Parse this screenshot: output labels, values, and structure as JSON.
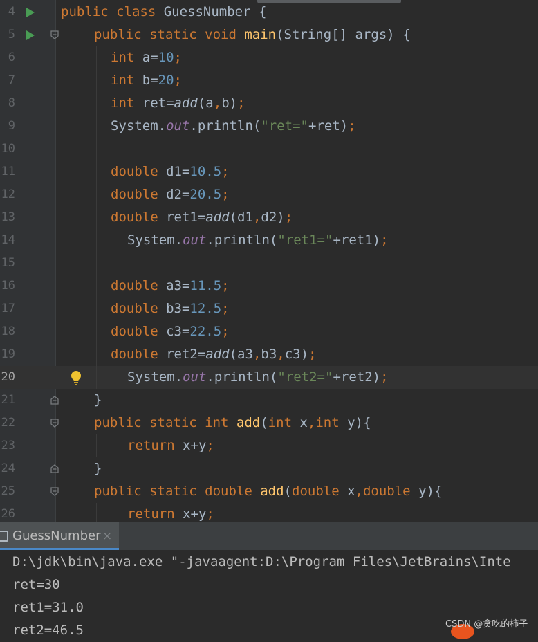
{
  "editor": {
    "lines": [
      {
        "n": "4",
        "tokens": [
          [
            "kw",
            "public class "
          ],
          [
            "p",
            "GuessNumber {"
          ]
        ]
      },
      {
        "n": "5",
        "tokens": [
          [
            "kw",
            "public static void "
          ],
          [
            "fn",
            "main"
          ],
          [
            "p",
            "(String[] args) {"
          ]
        ]
      },
      {
        "n": "6",
        "tokens": [
          [
            "kw",
            "int "
          ],
          [
            "p",
            "a="
          ],
          [
            "num",
            "10"
          ],
          [
            "kw",
            ";"
          ]
        ]
      },
      {
        "n": "7",
        "tokens": [
          [
            "kw",
            "int "
          ],
          [
            "p",
            "b="
          ],
          [
            "num",
            "20"
          ],
          [
            "kw",
            ";"
          ]
        ]
      },
      {
        "n": "8",
        "tokens": [
          [
            "kw",
            "int "
          ],
          [
            "p",
            "ret="
          ],
          [
            "it",
            "add"
          ],
          [
            "p",
            "(a"
          ],
          [
            "kw",
            ","
          ],
          [
            "p",
            "b)"
          ],
          [
            "kw",
            ";"
          ]
        ]
      },
      {
        "n": "9",
        "tokens": [
          [
            "p",
            "System."
          ],
          [
            "fld",
            "out"
          ],
          [
            "p",
            ".println("
          ],
          [
            "str",
            "\"ret=\""
          ],
          [
            "p",
            "+ret)"
          ],
          [
            "kw",
            ";"
          ]
        ]
      },
      {
        "n": "10",
        "tokens": []
      },
      {
        "n": "11",
        "tokens": [
          [
            "kw",
            "double "
          ],
          [
            "p",
            "d1="
          ],
          [
            "num",
            "10.5"
          ],
          [
            "kw",
            ";"
          ]
        ]
      },
      {
        "n": "12",
        "tokens": [
          [
            "kw",
            "double "
          ],
          [
            "p",
            "d2="
          ],
          [
            "num",
            "20.5"
          ],
          [
            "kw",
            ";"
          ]
        ]
      },
      {
        "n": "13",
        "tokens": [
          [
            "kw",
            "double "
          ],
          [
            "p",
            "ret1="
          ],
          [
            "it",
            "add"
          ],
          [
            "p",
            "(d1"
          ],
          [
            "kw",
            ","
          ],
          [
            "p",
            "d2)"
          ],
          [
            "kw",
            ";"
          ]
        ]
      },
      {
        "n": "14",
        "tokens": [
          [
            "p",
            "System."
          ],
          [
            "fld",
            "out"
          ],
          [
            "p",
            ".println("
          ],
          [
            "str",
            "\"ret1=\""
          ],
          [
            "p",
            "+ret1)"
          ],
          [
            "kw",
            ";"
          ]
        ]
      },
      {
        "n": "15",
        "tokens": []
      },
      {
        "n": "16",
        "tokens": [
          [
            "kw",
            "double "
          ],
          [
            "p",
            "a3="
          ],
          [
            "num",
            "11.5"
          ],
          [
            "kw",
            ";"
          ]
        ]
      },
      {
        "n": "17",
        "tokens": [
          [
            "kw",
            "double "
          ],
          [
            "p",
            "b3="
          ],
          [
            "num",
            "12.5"
          ],
          [
            "kw",
            ";"
          ]
        ]
      },
      {
        "n": "18",
        "tokens": [
          [
            "kw",
            "double "
          ],
          [
            "p",
            "c3="
          ],
          [
            "num",
            "22.5"
          ],
          [
            "kw",
            ";"
          ]
        ]
      },
      {
        "n": "19",
        "tokens": [
          [
            "kw",
            "double "
          ],
          [
            "p",
            "ret2="
          ],
          [
            "it",
            "add"
          ],
          [
            "p",
            "(a3"
          ],
          [
            "kw",
            ","
          ],
          [
            "p",
            "b3"
          ],
          [
            "kw",
            ","
          ],
          [
            "p",
            "c3)"
          ],
          [
            "kw",
            ";"
          ]
        ]
      },
      {
        "n": "20",
        "tokens": [
          [
            "p",
            "System."
          ],
          [
            "fld",
            "out"
          ],
          [
            "p",
            ".println("
          ],
          [
            "str",
            "\"ret2=\""
          ],
          [
            "p",
            "+ret2)"
          ],
          [
            "kw",
            ";"
          ]
        ]
      },
      {
        "n": "21",
        "tokens": [
          [
            "p",
            "}"
          ]
        ]
      },
      {
        "n": "22",
        "tokens": [
          [
            "kw",
            "public static int "
          ],
          [
            "fn",
            "add"
          ],
          [
            "p",
            "("
          ],
          [
            "kw",
            "int "
          ],
          [
            "p",
            "x"
          ],
          [
            "kw",
            ","
          ],
          [
            "kw",
            "int "
          ],
          [
            "p",
            "y){"
          ]
        ]
      },
      {
        "n": "23",
        "tokens": [
          [
            "kw",
            "return "
          ],
          [
            "p",
            "x+y"
          ],
          [
            "kw",
            ";"
          ]
        ]
      },
      {
        "n": "24",
        "tokens": [
          [
            "p",
            "}"
          ]
        ]
      },
      {
        "n": "25",
        "tokens": [
          [
            "kw",
            "public static double "
          ],
          [
            "fn",
            "add"
          ],
          [
            "p",
            "("
          ],
          [
            "kw",
            "double "
          ],
          [
            "p",
            "x"
          ],
          [
            "kw",
            ","
          ],
          [
            "kw",
            "double "
          ],
          [
            "p",
            "y){"
          ]
        ]
      },
      {
        "n": "26",
        "tokens": [
          [
            "kw",
            "return "
          ],
          [
            "p",
            "x+y"
          ],
          [
            "kw",
            ";"
          ]
        ]
      }
    ]
  },
  "run_panel": {
    "tab_label": "GuessNumber",
    "close_glyph": "×",
    "output": [
      "D:\\jdk\\bin\\java.exe \"-javaagent:D:\\Program Files\\JetBrains\\Inte",
      "ret=30",
      "ret1=31.0",
      "ret2=46.5"
    ]
  },
  "watermark": "CSDN @贪吃的柿子",
  "icons": {
    "run": "run-gutter-icon",
    "fold": "fold-icon",
    "bulb": "lightbulb-icon",
    "tab": "run-config-icon",
    "close": "close-icon"
  },
  "colors": {
    "keyword": "#cc7832",
    "number": "#6897bb",
    "string": "#6a8759",
    "method_decl": "#ffc66d",
    "field": "#9876aa",
    "text": "#a9b7c6",
    "background": "#2b2b2b",
    "run_icon": "#499c54",
    "bulb": "#f0c330",
    "tab_accent": "#4a88c7"
  }
}
